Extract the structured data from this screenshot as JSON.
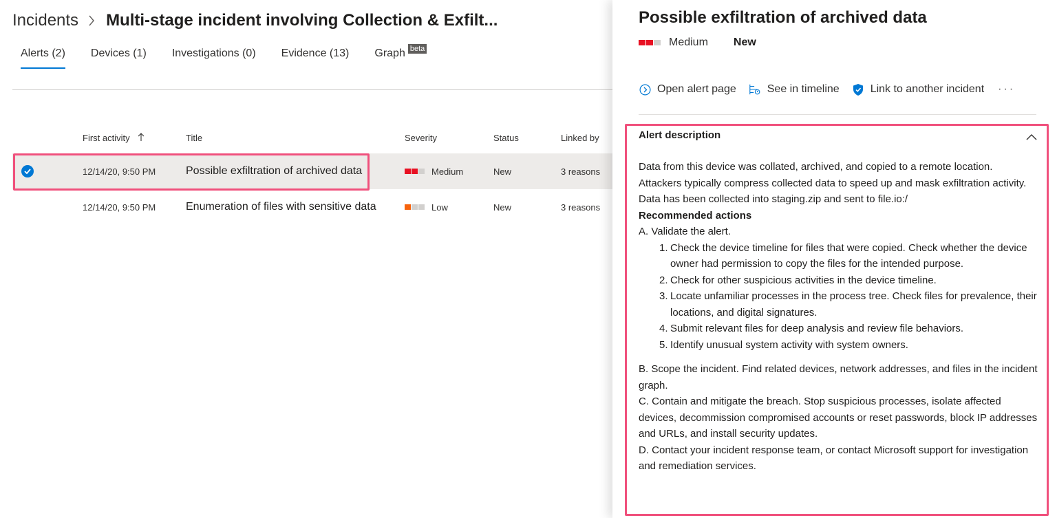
{
  "breadcrumb": {
    "root": "Incidents",
    "title": "Multi-stage incident involving Collection & Exfilt..."
  },
  "tabs": [
    {
      "label": "Alerts (2)",
      "active": true
    },
    {
      "label": "Devices (1)",
      "active": false
    },
    {
      "label": "Investigations (0)",
      "active": false
    },
    {
      "label": "Evidence (13)",
      "active": false
    },
    {
      "label": "Graph",
      "badge": "beta",
      "active": false
    }
  ],
  "table": {
    "columns": {
      "first_activity": "First activity",
      "title": "Title",
      "severity": "Severity",
      "status": "Status",
      "linked_by": "Linked by"
    },
    "sort_icon": "arrow-up-icon",
    "rows": [
      {
        "selected": true,
        "first_activity": "12/14/20, 9:50 PM",
        "title": "Possible exfiltration of archived data",
        "severity": "Medium",
        "status": "New",
        "linked_by": "3 reasons"
      },
      {
        "selected": false,
        "first_activity": "12/14/20, 9:50 PM",
        "title": "Enumeration of files with sensitive data",
        "severity": "Low",
        "status": "New",
        "linked_by": "3 reasons"
      }
    ]
  },
  "panel": {
    "title": "Possible exfiltration of archived data",
    "severity": "Medium",
    "status": "New",
    "actions": {
      "open_alert_page": "Open alert page",
      "see_in_timeline": "See in timeline",
      "link_incident": "Link to another incident",
      "more": "···"
    },
    "description": {
      "header": "Alert description",
      "lines": [
        "Data from this device was collated, archived, and copied to a remote location.",
        "Attackers typically compress collected data to speed up and mask exfiltration activity.",
        "Data has been collected into staging.zip and sent to file.io:/"
      ],
      "recommended_title": "Recommended actions",
      "step_a": "A. Validate the alert.",
      "steps": [
        {
          "num": "1.",
          "text": "Check the device timeline for files that were copied. Check whether the device owner had permission to copy the files for the intended purpose."
        },
        {
          "num": "2.",
          "text": "Check for other suspicious activities in the device timeline."
        },
        {
          "num": "3.",
          "text": "Locate unfamiliar processes in the process tree. Check files for prevalence, their locations, and digital signatures."
        },
        {
          "num": "4.",
          "text": "Submit relevant files for deep analysis and review file behaviors."
        },
        {
          "num": "5.",
          "text": "Identify unusual system activity with system owners."
        }
      ],
      "step_b": "B. Scope the incident. Find related devices, network addresses, and files in the incident graph.",
      "step_c": "C. Contain and mitigate the breach. Stop suspicious processes, isolate affected devices, decommission compromised accounts or reset passwords, block IP addresses and URLs, and install security updates.",
      "step_d": "D. Contact your incident response team, or contact Microsoft support for investigation and remediation services."
    }
  },
  "colors": {
    "accent": "#0078d4",
    "severity_medium": "#e81123",
    "severity_low": "#f7630c",
    "severity_empty": "#d2d0ce",
    "highlight": "#f0507c"
  }
}
